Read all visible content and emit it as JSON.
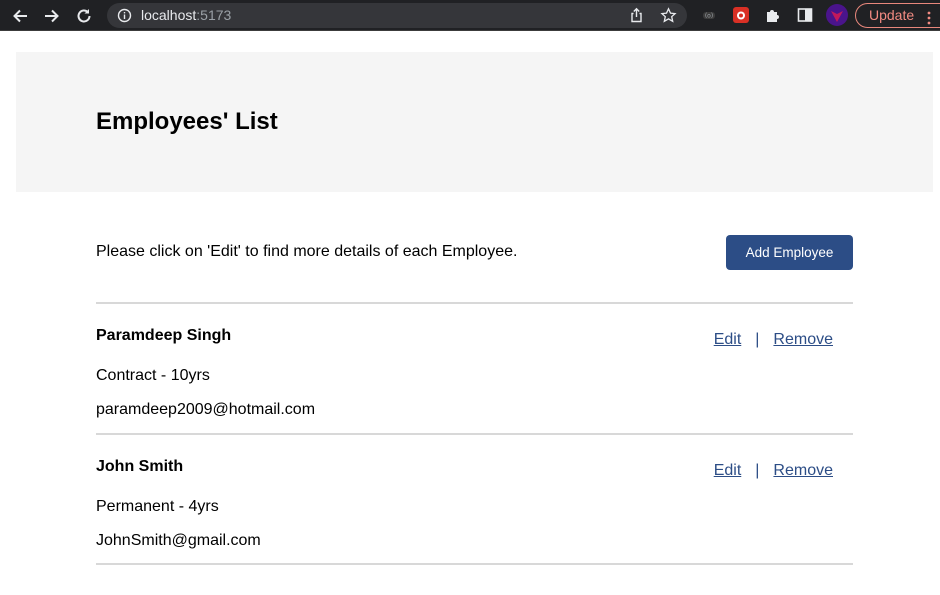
{
  "browser": {
    "url_host": "localhost",
    "url_port": ":5173",
    "update_label": "Update",
    "icons": [
      "back-arrow-icon",
      "forward-arrow-icon",
      "reload-icon",
      "info-icon",
      "share-icon",
      "star-icon",
      "extension-radio-icon",
      "extension-red-icon",
      "puzzle-icon",
      "sidebar-icon",
      "profile-avatar",
      "kebab-menu-icon"
    ]
  },
  "header": {
    "title": "Employees' List"
  },
  "intro": {
    "text": "Please click on 'Edit' to find more details of each Employee.",
    "add_button": "Add Employee"
  },
  "actions": {
    "edit": "Edit",
    "separator": "|",
    "remove": "Remove"
  },
  "employees": [
    {
      "name": "Paramdeep Singh",
      "type": "Contract - 10yrs",
      "email": "paramdeep2009@hotmail.com"
    },
    {
      "name": "John Smith",
      "type": "Permanent - 4yrs",
      "email": "JohnSmith@gmail.com"
    }
  ],
  "colors": {
    "accent": "#2c4d86",
    "header_bg": "#f5f5f5",
    "toolbar_bg": "#202124",
    "update_border": "#e8877c"
  }
}
